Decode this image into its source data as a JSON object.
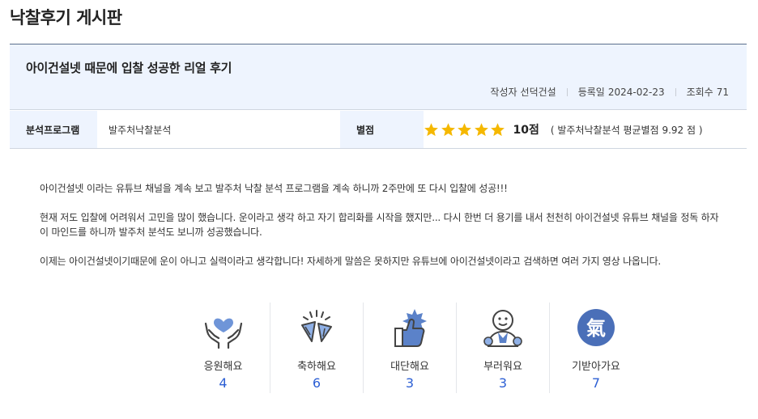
{
  "board": {
    "title": "낙찰후기 게시판"
  },
  "post": {
    "title": "아이건설넷 때문에 입찰 성공한 리얼 후기",
    "author_label": "작성자",
    "author": "선덕건설",
    "date_label": "등록일",
    "date": "2024-02-23",
    "views_label": "조회수",
    "views": "71"
  },
  "info": {
    "program_label": "분석프로그램",
    "program_value": "발주처낙찰분석",
    "rating_label": "별점",
    "stars": 5,
    "rating": 5,
    "star_color": "#f5b800",
    "score": "10점",
    "avg_text": "( 발주처낙찰분석 평균별점 9.92 점 )"
  },
  "content": {
    "paragraphs": [
      "아이건설넷 이라는 유튜브 채널을 계속 보고 발주처 낙찰 분석 프로그램을 계속 하니까 2주만에 또 다시 입찰에 성공!!!",
      "현재 저도 입찰에 어려워서 고민을 많이 했습니다. 운이라고 생각 하고 자기 합리화를 시작을 했지만... 다시 한번 더 용기를 내서 천천히 아이건설넷 유튜브 채널을 정독 하자 이 마인드를 하니까 발주처 분석도 보니까 성공했습니다.",
      "이제는 아이건설넷이기때문에 운이 아니고 실력이라고 생각합니다! 자세하게 말씀은 못하지만 유튜브에 아이건설넷이라고 검색하면 여러 가지 영상 나옵니다."
    ]
  },
  "reactions": [
    {
      "icon": "cheer-hands-heart-icon",
      "label": "응원해요",
      "count": "4"
    },
    {
      "icon": "party-popper-icon",
      "label": "축하해요",
      "count": "6"
    },
    {
      "icon": "thumbs-up-icon",
      "label": "대단해요",
      "count": "3"
    },
    {
      "icon": "envious-person-icon",
      "label": "부러워요",
      "count": "3"
    },
    {
      "icon": "energy-gi-icon",
      "label": "기받아가요",
      "count": "7"
    }
  ],
  "colors": {
    "accent": "#2c5fd4",
    "icon_blue": "#5b82c9",
    "header_bg": "#eef4fe"
  }
}
